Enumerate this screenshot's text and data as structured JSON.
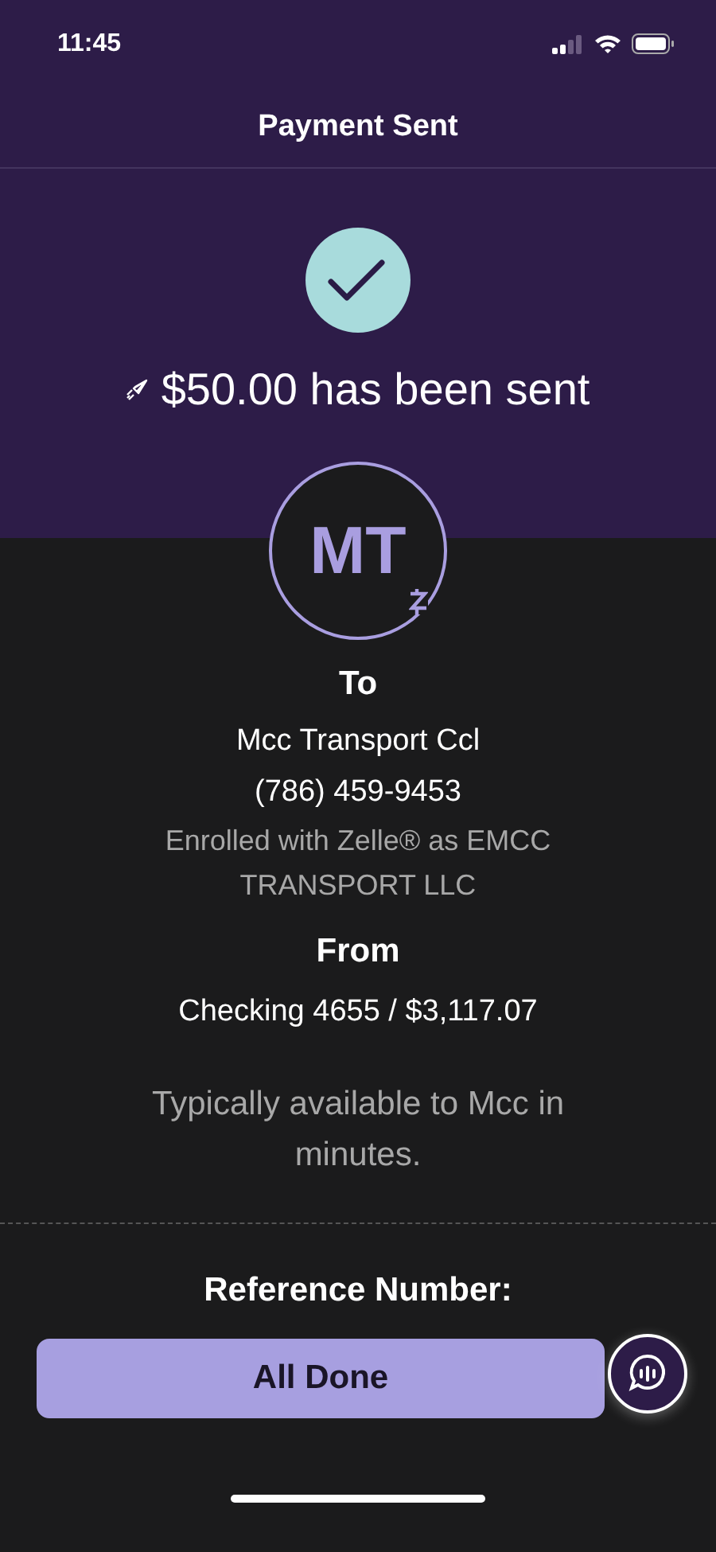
{
  "status_bar": {
    "time": "11:45"
  },
  "header": {
    "title": "Payment Sent"
  },
  "confirmation": {
    "amount_text": "$50.00 has been sent"
  },
  "recipient": {
    "initials": "MT",
    "label": "To",
    "name": "Mcc Transport Ccl",
    "phone": "(786) 459-9453",
    "enrollment": "Enrolled with Zelle® as EMCC TRANSPORT LLC"
  },
  "sender": {
    "label": "From",
    "account": "Checking 4655 / $3,117.07"
  },
  "availability": "Typically available to Mcc in minutes.",
  "reference": {
    "label": "Reference Number:"
  },
  "buttons": [
    "All Done"
  ]
}
